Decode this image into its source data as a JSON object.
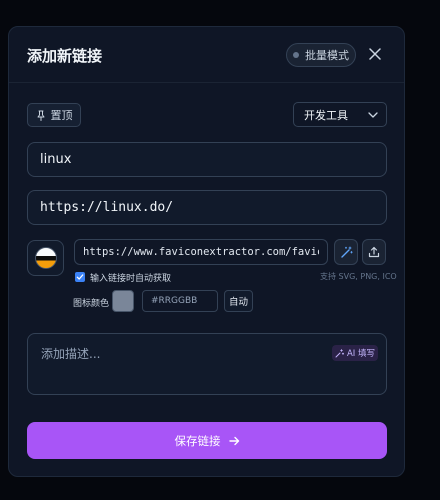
{
  "modal": {
    "title": "添加新链接",
    "batch_mode_label": "批量模式",
    "pin_label": "置顶",
    "category_value": "开发工具"
  },
  "form": {
    "name_value": "linux",
    "url_value": "https://linux.do/",
    "icon_url_value": "https://www.faviconextractor.com/favicon/l",
    "auto_fetch_label": "输入链接时自动获取",
    "auto_fetch_checked": true,
    "supported_formats": "支持 SVG, PNG, ICO",
    "icon_color_label": "图标颜色",
    "icon_color_swatch": "#7a8699",
    "hex_placeholder": "#RRGGBB",
    "auto_label": "自动",
    "description_placeholder": "添加描述...",
    "ai_fill_label": "AI 填写",
    "save_label": "保存链接"
  },
  "colors": {
    "accent": "#a855f7",
    "checkbox": "#3b82f6",
    "background": "#0f1626"
  },
  "icons": {
    "close": "close-icon",
    "pin": "pin-icon",
    "chevron": "chevron-down-icon",
    "magic": "magic-wand-icon",
    "upload": "upload-icon",
    "sparkle": "sparkle-icon",
    "arrow": "arrow-right-icon"
  }
}
